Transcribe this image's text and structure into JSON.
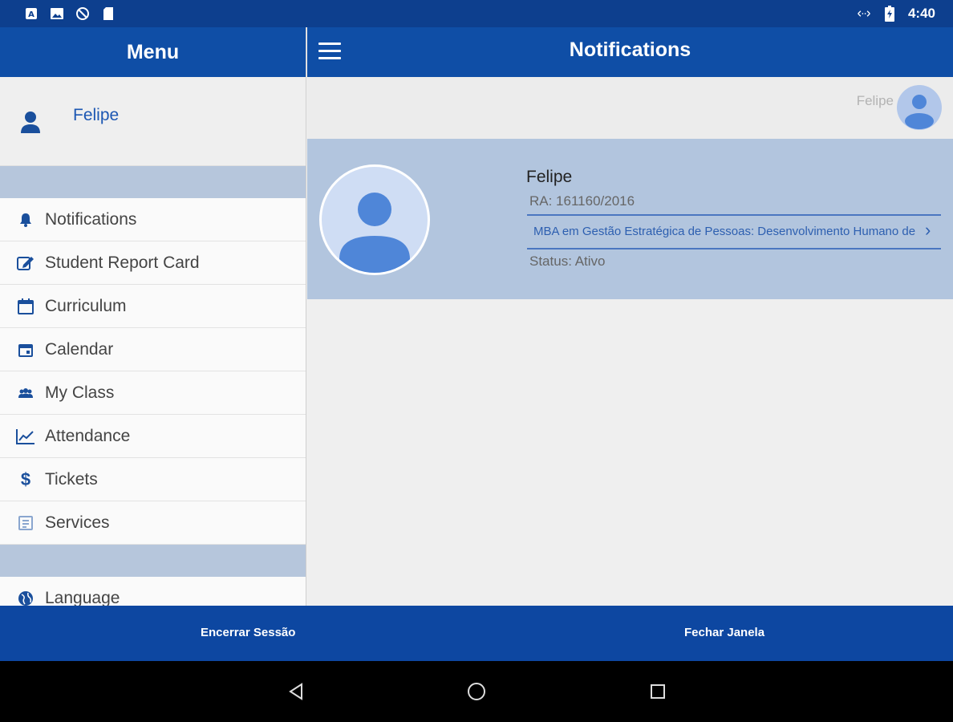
{
  "status_bar": {
    "time": "4:40",
    "left_icons": [
      "a-box-icon",
      "image-icon",
      "blocked-icon",
      "sd-card-icon"
    ],
    "right_icons": [
      "data-arrows-icon",
      "battery-charging-icon"
    ]
  },
  "drawer": {
    "title": "Menu",
    "user_name": "Felipe",
    "items": [
      {
        "label": "Notifications",
        "icon": "bell-icon"
      },
      {
        "label": "Student Report Card",
        "icon": "edit-icon"
      },
      {
        "label": "Curriculum",
        "icon": "calendar-blank-icon"
      },
      {
        "label": "Calendar",
        "icon": "calendar-event-icon"
      },
      {
        "label": "My Class",
        "icon": "group-icon"
      },
      {
        "label": "Attendance",
        "icon": "line-chart-icon"
      },
      {
        "label": "Tickets",
        "icon": "dollar-icon"
      },
      {
        "label": "Services",
        "icon": "services-icon"
      }
    ],
    "language_label": "Language"
  },
  "main": {
    "title": "Notifications",
    "user_name": "Felipe",
    "card": {
      "name": "Felipe",
      "ra": "RA: 161160/2016",
      "course": "MBA em Gestão Estratégica de Pessoas: Desenvolvimento Humano de",
      "status": "Status: Ativo"
    }
  },
  "bottom_bar": {
    "end_session": "Encerrar Sessão",
    "close_window": "Fechar Janela"
  },
  "colors": {
    "primary": "#0f4ea6",
    "status_bar": "#0d3f8e",
    "card_bg": "#b2c5de",
    "band": "#b6c6dc"
  }
}
